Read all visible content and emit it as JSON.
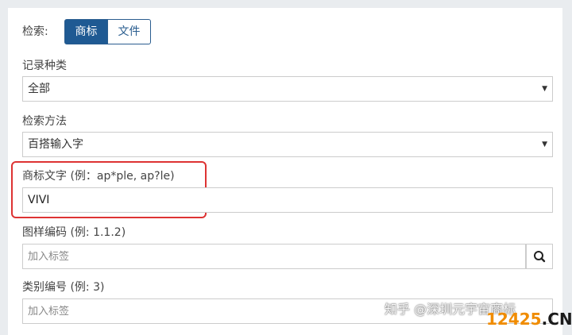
{
  "search": {
    "label": "检索:",
    "tabs": [
      "商标",
      "文件"
    ]
  },
  "record_type": {
    "label": "记录种类",
    "selected": "全部"
  },
  "search_method": {
    "label": "检索方法",
    "selected": "百搭输入字"
  },
  "trademark_text": {
    "label": "商标文字 (例：ap*ple, ap?le)",
    "value": "VIVI"
  },
  "design_code": {
    "label": "图样编码 (例: 1.1.2)",
    "placeholder": "加入标签"
  },
  "class_number": {
    "label": "类别编号 (例: 3)",
    "placeholder": "加入标签"
  },
  "watermark": {
    "text": "知乎 @深圳元宇宙商标",
    "site_a": "12425",
    "site_b": ".CN"
  },
  "colors": {
    "accent": "#1f5a93",
    "highlight": "#dd3333"
  }
}
